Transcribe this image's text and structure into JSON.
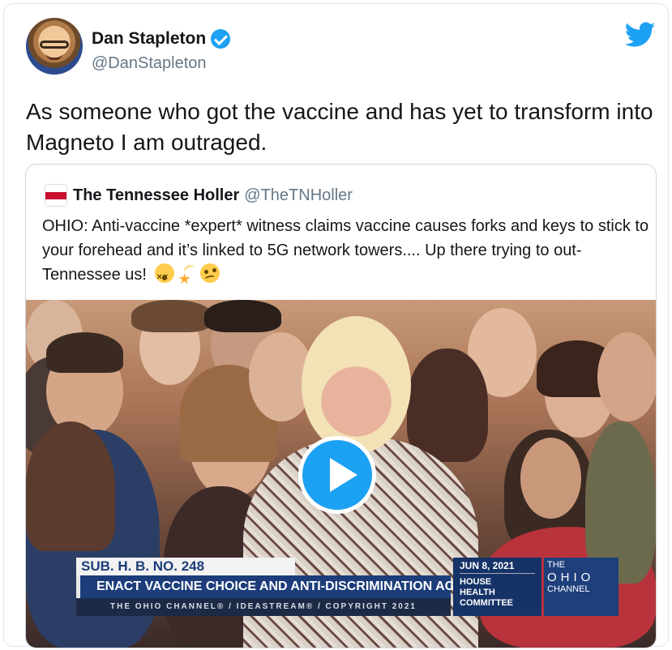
{
  "author": {
    "name": "Dan Stapleton",
    "handle": "@DanStapleton",
    "verified": true
  },
  "brand": {
    "icon": "twitter-bird-icon",
    "color": "#1da1f2"
  },
  "tweet": {
    "text": "As someone who got the vaccine and has yet to transform into Magneto I am outraged."
  },
  "quoted": {
    "name": "The Tennessee Holler",
    "handle": "@TheTNHoller",
    "text": "OHIO: Anti-vaccine *expert* witness claims vaccine causes forks and keys to stick to your forehead and it’s linked to 5G network towers.... Up there trying to out-Tennessee us!",
    "emojis": [
      "dizzy-face",
      "dizzy",
      "woozy-face"
    ],
    "video": {
      "bill": "SUB. H. B. NO. 248",
      "act": "ENACT VACCINE CHOICE AND ANTI-DISCRIMINATION ACT",
      "date": "JUN 8, 2021",
      "committee": [
        "HOUSE",
        "HEALTH",
        "COMMITTEE"
      ],
      "channel_the": "THE",
      "channel_ohio": "OHIO",
      "channel_name": "CHANNEL",
      "credit": "THE OHIO CHANNEL® / IDEASTREAM® / COPYRIGHT 2021",
      "play_icon": "play-icon"
    }
  }
}
